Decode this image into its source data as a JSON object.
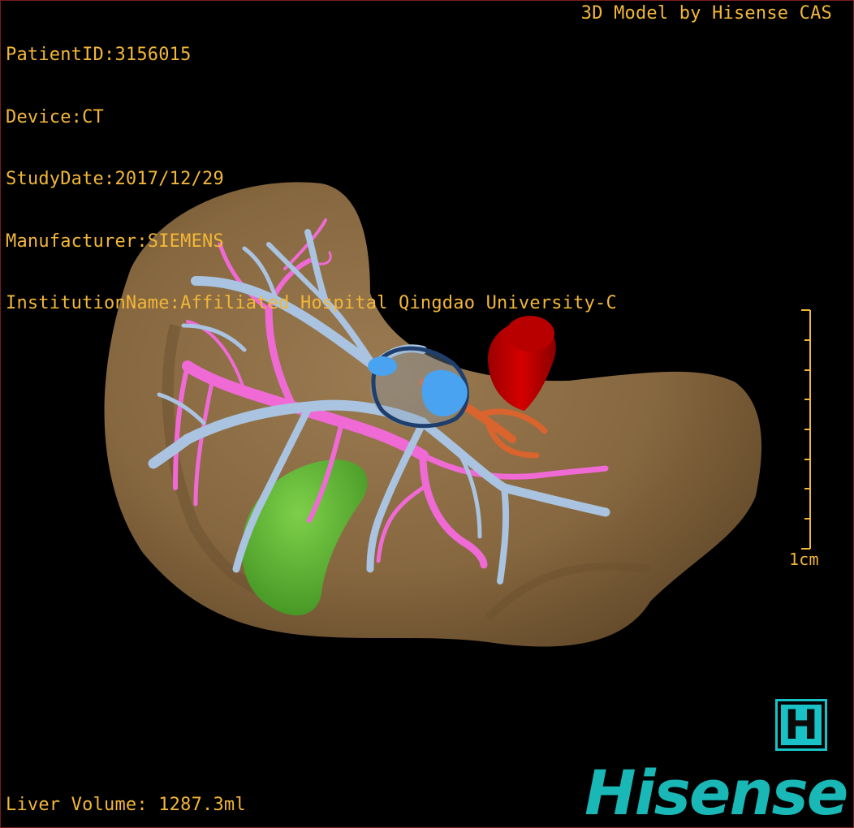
{
  "patient_info": {
    "patient_id": "PatientID:3156015",
    "device": "Device:CT",
    "study_date": "StudyDate:2017/12/29",
    "manufacturer": "Manufacturer:SIEMENS",
    "institution": "InstitutionName:Affiliated Hospital Qingdao University-C"
  },
  "model_credit": "3D Model by Hisense CAS",
  "liver_volume": "Liver Volume: 1287.3ml",
  "scale_bar": {
    "label": "1cm"
  },
  "brand": {
    "logo_letter": "H",
    "wordmark": "Hisense"
  },
  "colors": {
    "overlay_text": "#f2b738",
    "liver": "#8a6b45",
    "hepatic_vein": "#a9c3e0",
    "portal_vein": "#f06ad6",
    "gallbladder": "#5fc23a",
    "vena_cava": "#c80000",
    "tumor": "#4aa3f0",
    "brand": "#19b8b7"
  }
}
